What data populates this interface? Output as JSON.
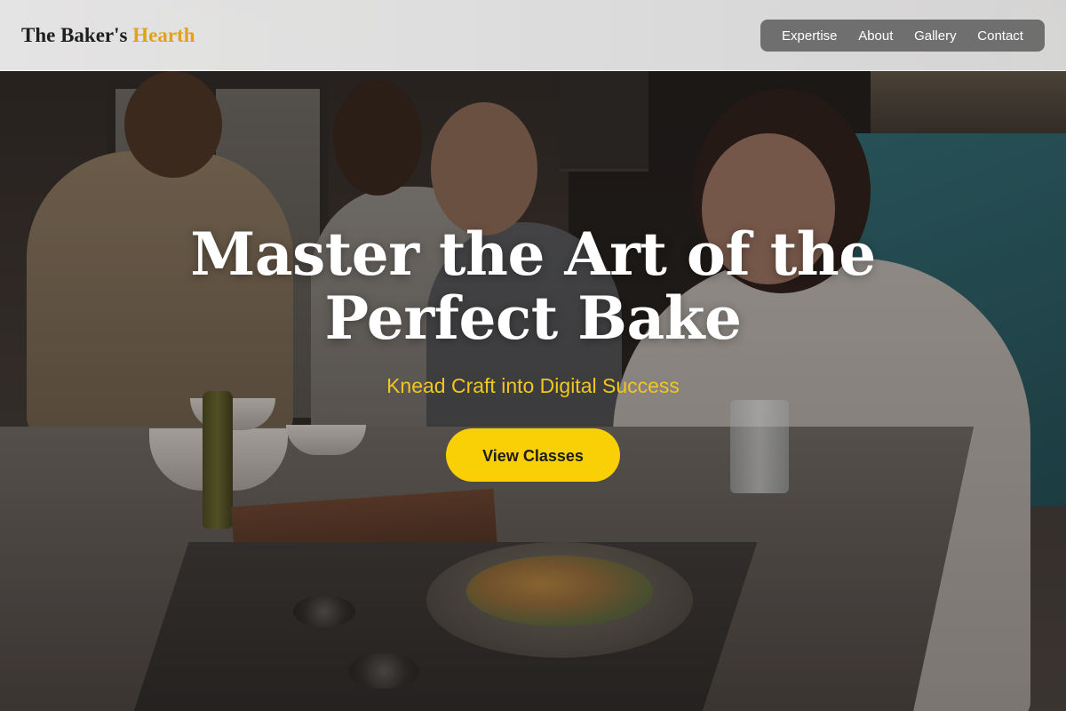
{
  "header": {
    "logo_main": "The Baker's",
    "logo_accent": "Hearth",
    "nav": [
      {
        "label": "Expertise"
      },
      {
        "label": "About"
      },
      {
        "label": "Gallery"
      },
      {
        "label": "Contact"
      }
    ]
  },
  "hero": {
    "title_line1": "Master the Art of the",
    "title_line2": "Perfect Bake",
    "subtitle": "Knead Craft into Digital Success",
    "cta_label": "View Classes"
  },
  "colors": {
    "accent_gold": "#e0a21b",
    "subtitle_yellow": "#f2c51f",
    "cta_yellow": "#f9d006",
    "nav_bg": "#585858"
  }
}
